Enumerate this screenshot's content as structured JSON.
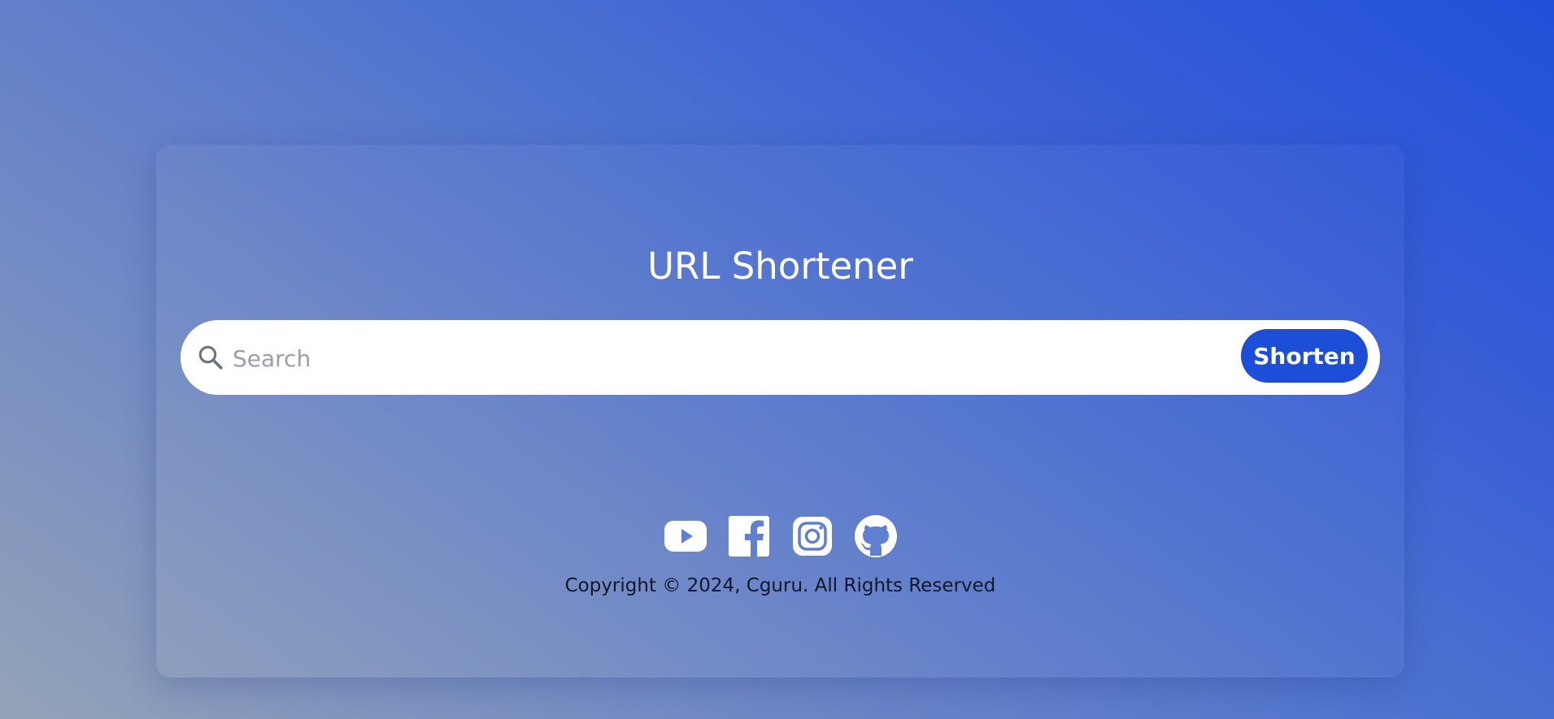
{
  "page": {
    "title": "URL Shortener"
  },
  "search": {
    "placeholder": "Search",
    "value": "",
    "icon": "search-icon"
  },
  "actions": {
    "shorten_label": "Shorten"
  },
  "socials": [
    {
      "name": "youtube",
      "icon": "youtube-icon"
    },
    {
      "name": "facebook",
      "icon": "facebook-icon"
    },
    {
      "name": "instagram",
      "icon": "instagram-icon"
    },
    {
      "name": "github",
      "icon": "github-icon"
    }
  ],
  "footer": {
    "copyright": "Copyright © 2024, Cguru. All Rights Reserved"
  },
  "colors": {
    "accent": "#1d4ed8",
    "background_start": "#93a3b8",
    "background_end": "#2150d9",
    "text_light": "#ffffff",
    "text_dark": "#111827"
  }
}
